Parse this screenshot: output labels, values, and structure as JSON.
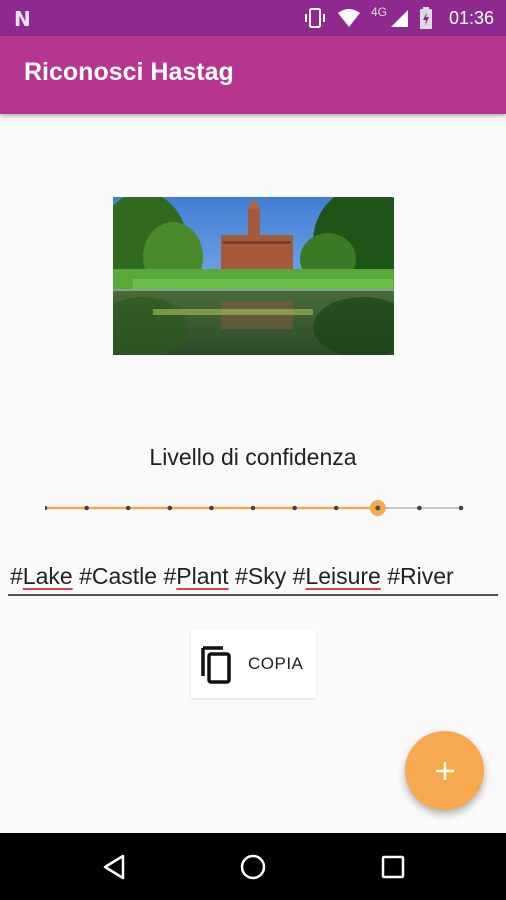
{
  "status_bar": {
    "time": "01:36",
    "network": "4G",
    "icons": [
      "n-logo-icon",
      "vibrate-icon",
      "wifi-icon",
      "signal-icon",
      "battery-charging-icon"
    ]
  },
  "app_bar": {
    "title": "Riconosci Hastag",
    "color": "#b5358f"
  },
  "image": {
    "icon": "castle-lake-photo"
  },
  "confidence": {
    "label": "Livello di confidenza",
    "steps": 11,
    "selected_step": 8,
    "value_fraction": 0.8,
    "accent_color": "#f6a94e"
  },
  "hashtags": {
    "value": "#Lake #Castle #Plant #Sky #Leisure #River",
    "tags": [
      "#Lake",
      "#Castle",
      "#Plant",
      "#Sky",
      "#Leisure",
      "#River"
    ],
    "misspelled": [
      "Lake",
      "Plant",
      "Leisure"
    ]
  },
  "copy_button": {
    "label": "COPIA",
    "icon": "copy-icon"
  },
  "fab": {
    "icon": "plus-icon",
    "color": "#f6a94e"
  },
  "nav_bar": {
    "icons": [
      "back-icon",
      "home-icon",
      "recents-icon"
    ]
  }
}
